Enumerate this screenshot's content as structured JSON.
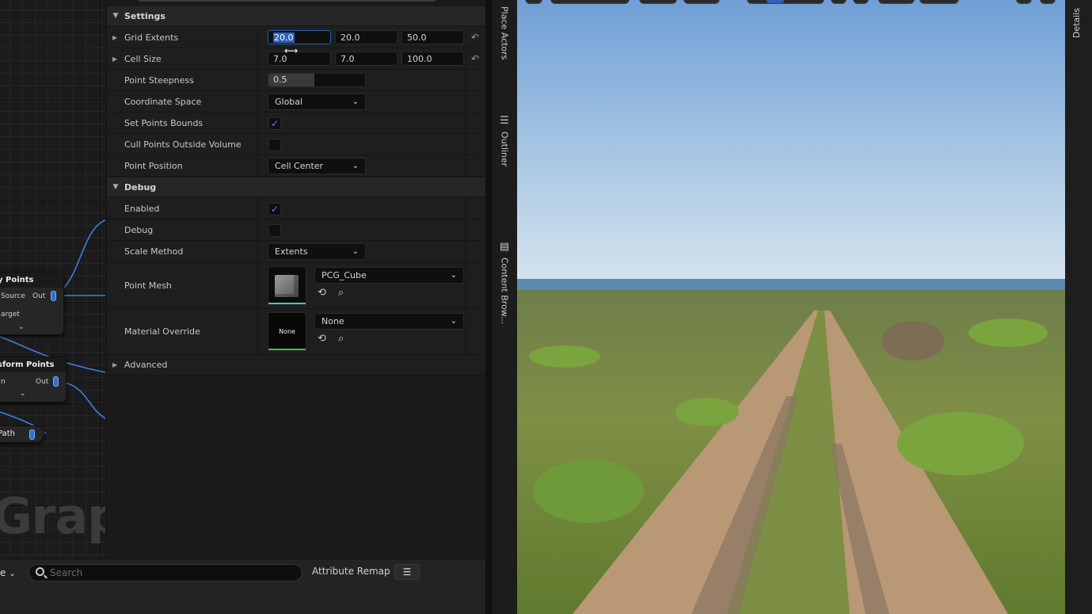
{
  "graph": {
    "watermark": "Graph",
    "nodes": [
      {
        "title": "y Points",
        "pin_left": "Source",
        "pin_right": "Out",
        "pin_left2": "arget"
      },
      {
        "title": "sform Points",
        "pin_left": "n",
        "pin_right": "Out"
      },
      {
        "title": "Path"
      }
    ]
  },
  "details": {
    "sections": {
      "settings": "Settings",
      "debug": "Debug",
      "advanced": "Advanced"
    },
    "grid_extents": {
      "label": "Grid Extents",
      "x": "20.0",
      "y": "20.0",
      "z": "50.0"
    },
    "cell_size": {
      "label": "Cell Size",
      "x": "7.0",
      "y": "7.0",
      "z": "100.0"
    },
    "point_steepness": {
      "label": "Point Steepness",
      "value": "0.5",
      "fill_fraction": 0.5
    },
    "coordinate_space": {
      "label": "Coordinate Space",
      "value": "Global"
    },
    "set_points_bounds": {
      "label": "Set Points Bounds",
      "checked": true
    },
    "cull_points_outside_volume": {
      "label": "Cull Points Outside Volume",
      "checked": false
    },
    "point_position": {
      "label": "Point Position",
      "value": "Cell Center"
    },
    "enabled": {
      "label": "Enabled",
      "checked": true
    },
    "debug": {
      "label": "Debug",
      "checked": false
    },
    "scale_method": {
      "label": "Scale Method",
      "value": "Extents"
    },
    "point_mesh": {
      "label": "Point Mesh",
      "value": "PCG_Cube"
    },
    "material_override": {
      "label": "Material Override",
      "value": "None",
      "thumb_text": "None"
    }
  },
  "bottombar": {
    "search_placeholder": "Search",
    "attribute_remap": "Attribute Remap",
    "left_combo": "e"
  },
  "side_tabs": {
    "place_actors": "Place Actors",
    "outliner": "Outliner",
    "content_browser": "Content Brow..."
  },
  "right_tab": "Details",
  "icons": {
    "settings_caret": "caret-down-icon",
    "reset": "reset-arrow-icon",
    "dropdown": "chevron-down-icon",
    "check": "checkmark-icon",
    "browse": "browse-asset-icon",
    "use_selected": "use-selected-icon",
    "search": "search-icon",
    "menu": "hamburger-menu-icon"
  },
  "colors": {
    "accent": "#2f62b8",
    "check": "#4a8cf0",
    "pin": "#2f6fd6",
    "wire": "#3c7fe0"
  }
}
